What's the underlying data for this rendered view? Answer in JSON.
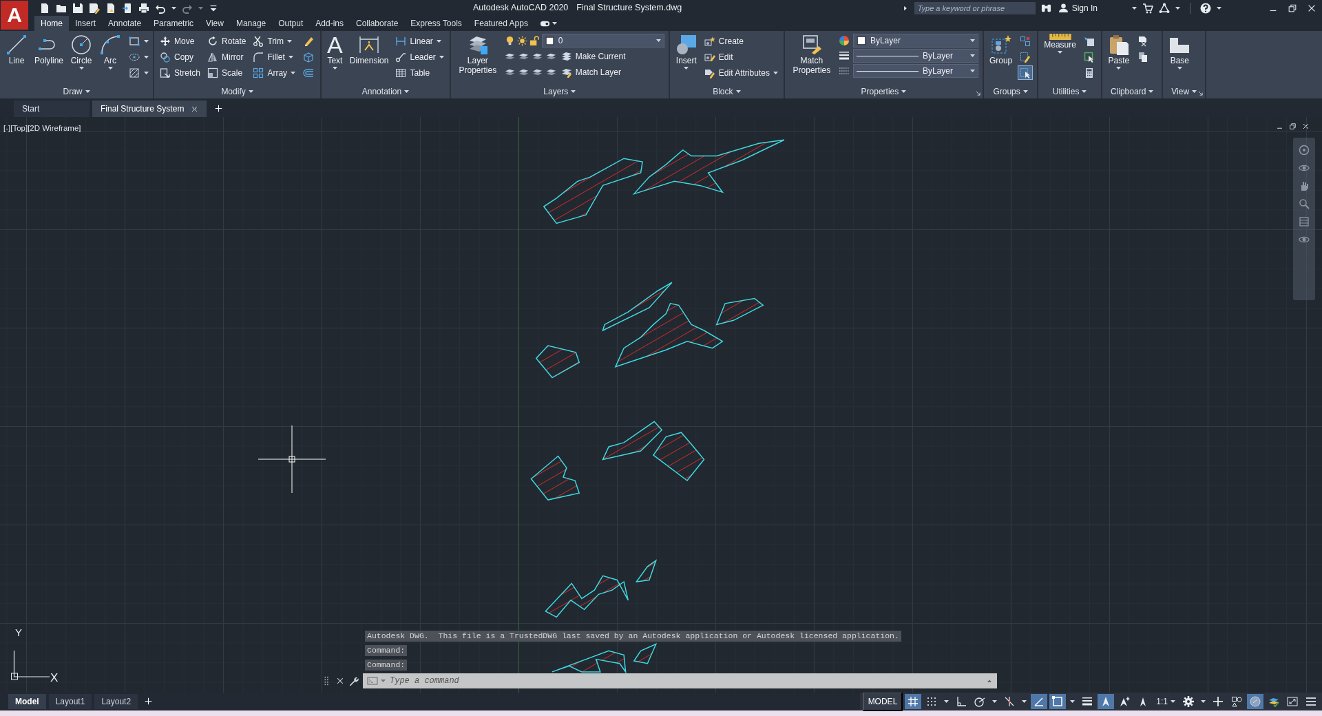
{
  "app_logo": "A",
  "title_bar": {
    "app_name": "Autodesk AutoCAD 2020",
    "file_name": "Final Structure System.dwg",
    "search": {
      "placeholder": "Type a keyword or phrase"
    },
    "sign_in": "Sign In"
  },
  "ribbon_tabs": [
    {
      "label": "Home",
      "selected": true
    },
    {
      "label": "Insert",
      "selected": false
    },
    {
      "label": "Annotate",
      "selected": false
    },
    {
      "label": "Parametric",
      "selected": false
    },
    {
      "label": "View",
      "selected": false
    },
    {
      "label": "Manage",
      "selected": false
    },
    {
      "label": "Output",
      "selected": false
    },
    {
      "label": "Add-ins",
      "selected": false
    },
    {
      "label": "Collaborate",
      "selected": false
    },
    {
      "label": "Express Tools",
      "selected": false
    },
    {
      "label": "Featured Apps",
      "selected": false
    }
  ],
  "ribbon_panels": [
    {
      "title": "Draw",
      "launcher": false,
      "groups": [
        {
          "kind": "large",
          "label": "Line",
          "menu": false
        },
        {
          "kind": "large",
          "label": "Polyline",
          "menu": false
        },
        {
          "kind": "large",
          "label": "Circle",
          "menu": true
        },
        {
          "kind": "large",
          "label": "Arc",
          "menu": true
        },
        {
          "kind": "icons",
          "items": [
            {
              "menu": true,
              "on": false
            },
            {
              "menu": true,
              "on": false
            },
            {
              "menu": true,
              "on": false
            }
          ]
        }
      ]
    },
    {
      "title": "Modify",
      "launcher": false,
      "groups": [
        {
          "kind": "stack",
          "items": [
            {
              "label": "Move",
              "menu": false
            },
            {
              "label": "Copy",
              "menu": false
            },
            {
              "label": "Stretch",
              "menu": false
            }
          ]
        },
        {
          "kind": "stack",
          "items": [
            {
              "label": "Rotate",
              "menu": false
            },
            {
              "label": "Mirror",
              "menu": false
            },
            {
              "label": "Scale",
              "menu": false
            }
          ]
        },
        {
          "kind": "stack",
          "items": [
            {
              "label": "Trim",
              "menu": true
            },
            {
              "label": "Fillet",
              "menu": true
            },
            {
              "label": "Array",
              "menu": true
            }
          ]
        },
        {
          "kind": "icons",
          "items": [
            {
              "menu": false,
              "on": false
            },
            {
              "menu": false,
              "on": false
            },
            {
              "menu": false,
              "on": false
            }
          ]
        }
      ]
    },
    {
      "title": "Annotation",
      "launcher": false,
      "groups": [
        {
          "kind": "large",
          "label": "Text",
          "glyph": "A",
          "menu": true
        },
        {
          "kind": "large",
          "label": "Dimension",
          "menu": false
        },
        {
          "kind": "stack",
          "items": [
            {
              "label": "Linear",
              "menu": true
            },
            {
              "label": "Leader",
              "menu": true
            },
            {
              "label": "Table",
              "menu": false
            }
          ]
        }
      ]
    },
    {
      "title": "Layers",
      "launcher": false,
      "groups": [
        {
          "kind": "large",
          "label": "Layer Properties",
          "menu": false
        },
        {
          "kind": "layer-stack",
          "current_layer": "0",
          "items": [
            {
              "label": "Make Current",
              "menu": false
            },
            {
              "label": "Match Layer",
              "menu": false
            }
          ]
        }
      ]
    },
    {
      "title": "Block",
      "launcher": false,
      "groups": [
        {
          "kind": "large",
          "label": "Insert",
          "menu": true
        },
        {
          "kind": "stack",
          "items": [
            {
              "label": "Create",
              "menu": false
            },
            {
              "label": "Edit",
              "menu": false
            },
            {
              "label": "Edit Attributes",
              "menu": true
            }
          ]
        }
      ]
    },
    {
      "title": "Properties",
      "launcher": true,
      "groups": [
        {
          "kind": "large",
          "label": "Match Properties",
          "menu": false
        },
        {
          "kind": "property-stack",
          "items": [
            {
              "kind": "color",
              "value": "ByLayer"
            },
            {
              "kind": "lineweight",
              "value": "ByLayer"
            },
            {
              "kind": "linetype",
              "value": "ByLayer"
            }
          ]
        }
      ]
    },
    {
      "title": "Groups",
      "launcher": false,
      "groups": [
        {
          "kind": "large",
          "label": "Group",
          "menu": false
        },
        {
          "kind": "icons",
          "items": [
            {
              "menu": false,
              "on": false
            },
            {
              "menu": false,
              "on": false
            },
            {
              "menu": false,
              "on": true
            }
          ]
        }
      ]
    },
    {
      "title": "Utilities",
      "launcher": false,
      "groups": [
        {
          "kind": "large",
          "label": "Measure",
          "menu": true
        },
        {
          "kind": "icons",
          "items": [
            {
              "menu": false,
              "on": false
            },
            {
              "menu": false,
              "on": false
            },
            {
              "menu": false,
              "on": false
            }
          ]
        }
      ]
    },
    {
      "title": "Clipboard",
      "launcher": false,
      "groups": [
        {
          "kind": "large",
          "label": "Paste",
          "menu": true
        },
        {
          "kind": "icons",
          "items": [
            {
              "menu": false,
              "on": false
            },
            {
              "menu": false,
              "on": false
            }
          ]
        }
      ]
    },
    {
      "title": "View",
      "launcher": true,
      "groups": [
        {
          "kind": "large",
          "label": "Base",
          "menu": true
        }
      ]
    }
  ],
  "document_tabs": [
    {
      "label": "Start",
      "selected": false,
      "closable": false
    },
    {
      "label": "Final Structure System",
      "selected": true,
      "closable": true
    }
  ],
  "viewport": {
    "label": "[-][Top][2D Wireframe]",
    "ucs": {
      "y_label": "Y",
      "x_label": "X"
    }
  },
  "command_line": {
    "history": [
      "Autodesk DWG.  This file is a TrustedDWG last saved by an Autodesk application or Autodesk licensed application.",
      "Command:",
      "Command:"
    ],
    "placeholder": "Type a command"
  },
  "layout_tabs": [
    {
      "label": "Model",
      "selected": true
    },
    {
      "label": "Layout1",
      "selected": false
    },
    {
      "label": "Layout2",
      "selected": false
    }
  ],
  "status_bar": {
    "space": "MODEL",
    "scale": "1:1",
    "toggles": [
      {
        "on": true,
        "menu": false
      },
      {
        "on": false,
        "menu": true
      },
      {
        "on": false,
        "menu": false
      },
      {
        "on": false,
        "menu": true
      },
      {
        "on": false,
        "menu": true
      },
      {
        "on": true,
        "menu": false
      },
      {
        "on": true,
        "menu": true
      },
      {
        "on": false,
        "menu": false
      },
      {
        "on": true,
        "menu": false
      },
      {
        "on": false,
        "menu": false
      },
      {
        "on": false,
        "menu": false
      },
      {
        "on": false,
        "menu": true
      },
      {
        "on": false,
        "menu": false
      },
      {
        "on": false,
        "menu": false
      },
      {
        "on": true,
        "menu": false
      },
      {
        "on": false,
        "menu": false
      },
      {
        "on": false,
        "menu": false
      },
      {
        "on": false,
        "menu": false
      }
    ]
  }
}
